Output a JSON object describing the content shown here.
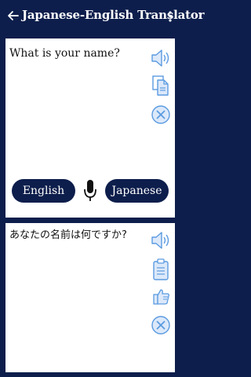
{
  "appbar": {
    "title": "Japanese-English Translator"
  },
  "input": {
    "text": "What is your name?"
  },
  "buttons": {
    "source_lang": "English",
    "target_lang": "Japanese"
  },
  "output": {
    "text": "あなたの名前は何ですか?"
  },
  "colors": {
    "primary": "#0d1e4c",
    "icon_blue": "#5b9be0",
    "background": "#0d1e4c",
    "card": "#ffffff"
  }
}
